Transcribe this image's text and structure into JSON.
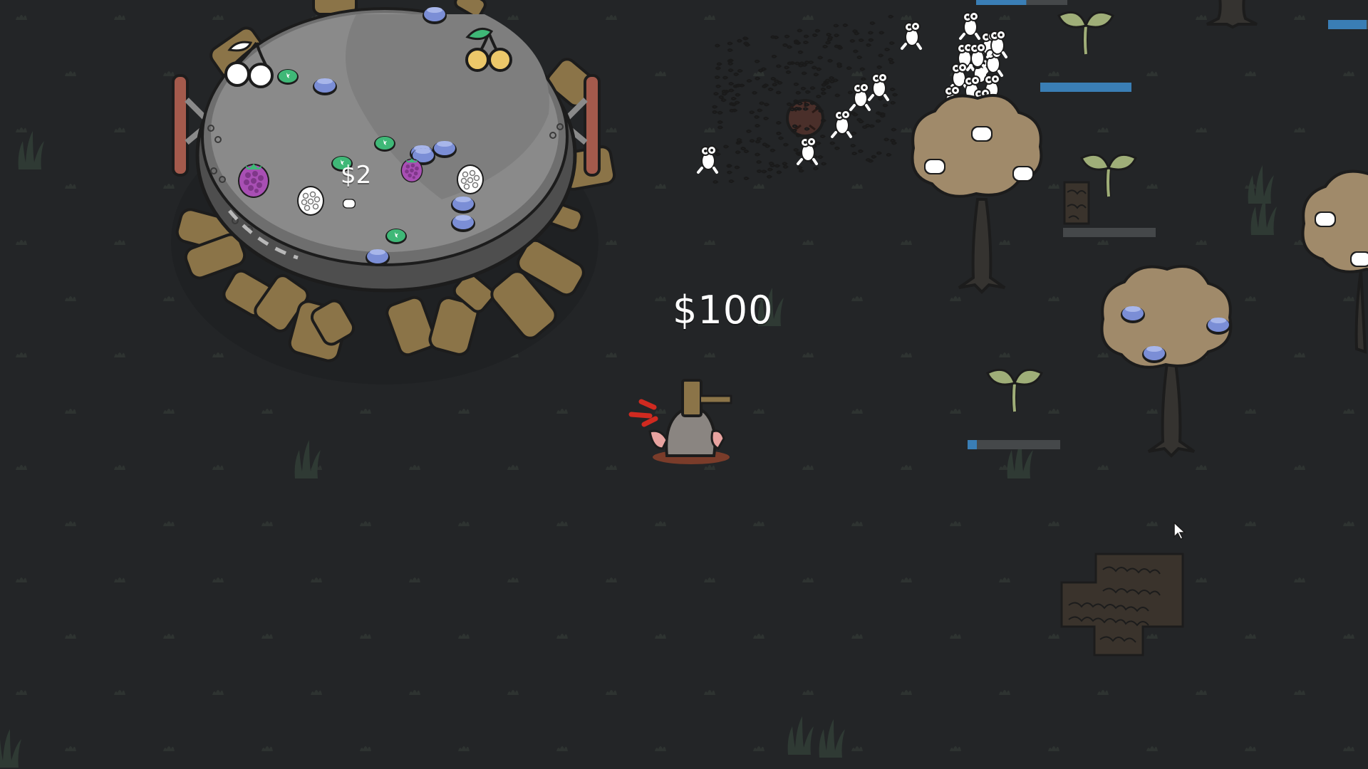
{
  "hud": {
    "money": "$100",
    "cauldron_price": "$2"
  },
  "colors": {
    "ground": "#232527",
    "grass_tuft": "#2e3331",
    "cauldron_rim": "#6e6e6e",
    "cauldron_fill": "#8a8a8a",
    "log": "#8b7448",
    "tree_canopy": "#a08a6a",
    "tree_trunk": "#353330",
    "sprout_leaf": "#9fae78",
    "blueberry": "#7b8ed6",
    "green_gem": "#3fb877",
    "raspberry": "#a84fb4",
    "cherry_white": "#ffffff",
    "cherry_yellow": "#ecc86a",
    "progress_fill": "#3a7eb5",
    "progress_track": "#45484a",
    "thorn_bush": "#3a332c"
  },
  "cauldron": {
    "items": [
      "white-cherries",
      "yellow-cherries",
      "blueberry",
      "green-gem",
      "raspberry",
      "white-raspberry",
      "white-blob"
    ]
  },
  "player": {
    "icon": "mole-with-hammer-icon"
  },
  "progress": {
    "top_center": 0.55,
    "top_right_edge": 0.9,
    "sprout_top": 1.0,
    "sprout_mid": 0.0,
    "sprout_bottom": 0.1
  },
  "trees": [
    {
      "name": "cloud-tree",
      "fruit": "white-blob"
    },
    {
      "name": "blueberry-tree",
      "fruit": "blueberry"
    },
    {
      "name": "edge-tree",
      "fruit": "white-blob"
    }
  ],
  "hazards": [
    "white-critter-swarm",
    "thorn-bush",
    "spiky-ball"
  ]
}
